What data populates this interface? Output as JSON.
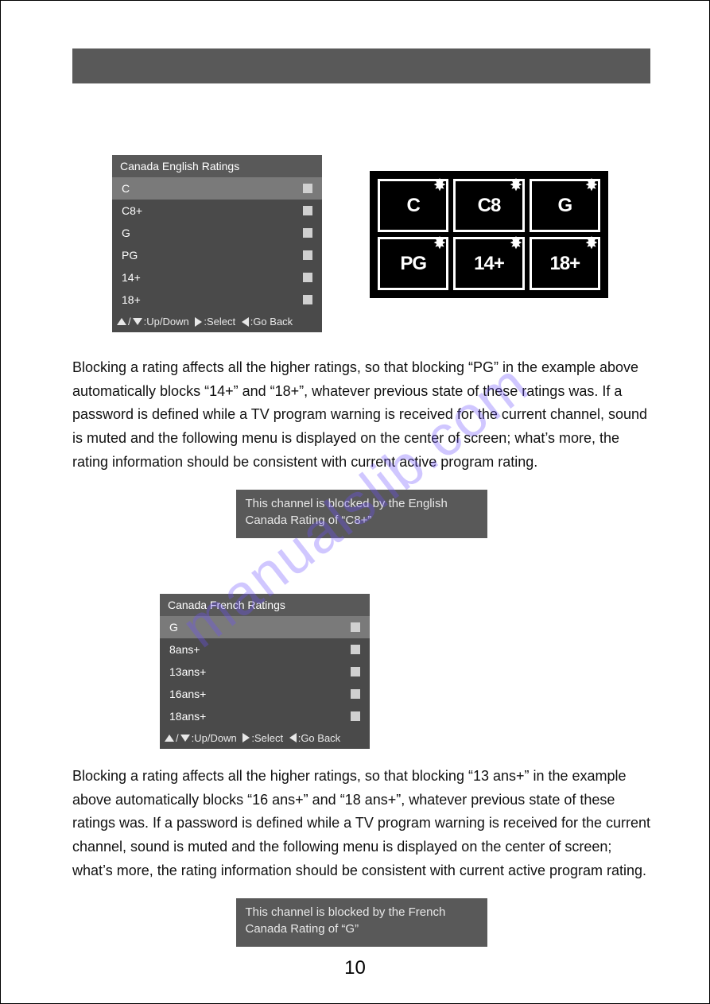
{
  "watermark": "manualslib.com",
  "page_number": "10",
  "menu_english": {
    "title": "Canada English Ratings",
    "items": [
      "C",
      "C8+",
      "G",
      "PG",
      "14+",
      "18+"
    ],
    "footer": {
      "updown": ":Up/Down",
      "select": ":Select",
      "back": ":Go Back"
    }
  },
  "badges": [
    "C",
    "C8",
    "G",
    "PG",
    "14+",
    "18+"
  ],
  "paragraph_1": "Blocking a rating affects all the higher ratings, so that blocking “PG” in the example above automatically blocks “14+” and “18+”, whatever previous state of these ratings was. If a password is defined while a TV program warning is received for the current channel, sound is muted and the following menu is displayed on the center of screen; what’s more, the rating information should be consistent with current active program rating.",
  "blocked_msg_1": "This channel is blocked by the English Canada Rating of “C8+”",
  "menu_french": {
    "title": "Canada French Ratings",
    "items": [
      "G",
      "8ans+",
      "13ans+",
      "16ans+",
      "18ans+"
    ],
    "footer": {
      "updown": ":Up/Down",
      "select": ":Select",
      "back": ":Go Back"
    }
  },
  "paragraph_2": "Blocking a rating affects all the higher ratings, so that blocking “13 ans+” in the example above automatically blocks “16 ans+” and “18 ans+”, whatever previous state of these ratings was. If a password is defined while a TV program warning is received for the current channel, sound is muted and the following menu is displayed on the center of screen; what’s more, the rating information should be consistent with current active program rating.",
  "blocked_msg_2": "This channel is blocked by the French Canada Rating of “G”"
}
